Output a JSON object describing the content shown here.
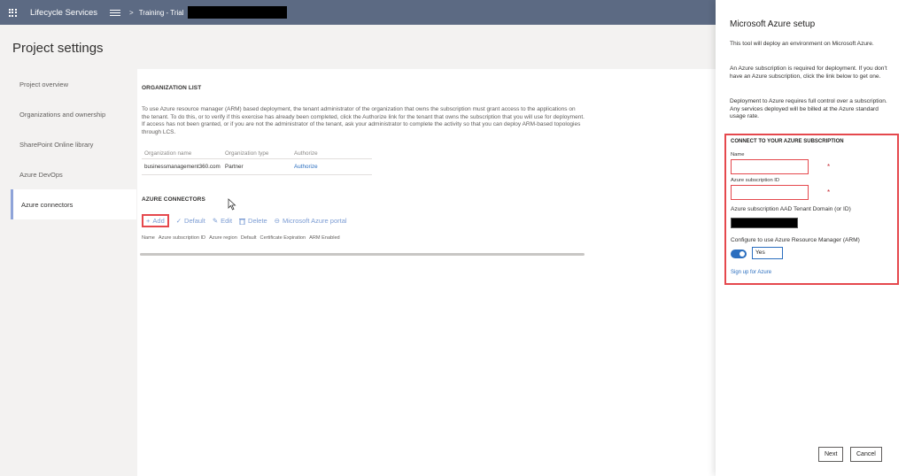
{
  "topbar": {
    "app_title": "Lifecycle Services",
    "breadcrumb_separator": ">",
    "breadcrumb": "Training - Trial"
  },
  "page": {
    "title": "Project settings"
  },
  "sidebar": {
    "items": [
      {
        "label": "Project overview",
        "active": false
      },
      {
        "label": "Organizations and ownership",
        "active": false
      },
      {
        "label": "SharePoint Online library",
        "active": false
      },
      {
        "label": "Azure DevOps",
        "active": false
      },
      {
        "label": "Azure connectors",
        "active": true
      }
    ]
  },
  "org_list": {
    "heading": "ORGANIZATION LIST",
    "description": "To use Azure resource manager (ARM) based deployment, the tenant administrator of the organization that owns the subscription must grant access to the applications on the tenant. To do this, or to verify if this exercise has already been completed, click the Authorize link for the tenant that owns the subscription that you will use for deployment. If access has not been granted, or if you are not the administrator of the tenant, ask your administrator to complete the activity so that you can deploy ARM-based topologies through LCS.",
    "columns": [
      "Organization name",
      "Organization type",
      "Authorize"
    ],
    "rows": [
      {
        "name": "businessmanagement360.com",
        "type": "Partner",
        "authorize": "Authorize"
      }
    ]
  },
  "azure_connectors": {
    "heading": "AZURE CONNECTORS",
    "toolbar": {
      "add": "Add",
      "default": "Default",
      "edit": "Edit",
      "delete": "Delete",
      "portal": "Microsoft Azure portal"
    },
    "columns": [
      "Name",
      "Azure subscription ID",
      "Azure region",
      "Default",
      "Certificate Expiration",
      "ARM Enabled"
    ]
  },
  "panel": {
    "title": "Microsoft Azure setup",
    "para1": "This tool will deploy an environment on Microsoft Azure.",
    "para2": "An Azure subscription is required for deployment. If you don't have an Azure subscription, click the link below to get one.",
    "para3": "Deployment to Azure requires full control over a subscription. Any services deployed will be billed at the Azure standard usage rate.",
    "connect_heading": "CONNECT TO YOUR AZURE SUBSCRIPTION",
    "name_label": "Name",
    "name_value": "",
    "subscription_label": "Azure subscription ID",
    "subscription_value": "",
    "required_mark": "*",
    "tenant_label": "Azure subscription AAD Tenant Domain (or ID)",
    "arm_label": "Configure to use Azure Resource Manager (ARM)",
    "arm_value": "Yes",
    "signup_link": "Sign up for Azure",
    "next_button": "Next",
    "cancel_button": "Cancel"
  },
  "colors": {
    "topbar": "#5c6a83",
    "accent_link": "#2a6ebf",
    "highlight_red": "#e5484d",
    "active_bar": "#8fa4d9"
  }
}
